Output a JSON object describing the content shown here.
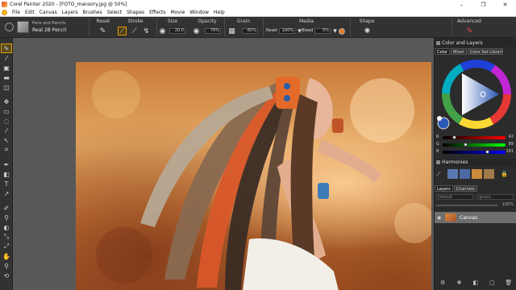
{
  "window": {
    "title": "Corel Painter 2020 - [FOTO_mansory.jpg @ 50%]",
    "controls": [
      "–",
      "❐",
      "✕"
    ]
  },
  "menu": [
    "File",
    "Edit",
    "Canvas",
    "Layers",
    "Brushes",
    "Select",
    "Shapes",
    "Effects",
    "Movie",
    "Window",
    "Help"
  ],
  "property_bar": {
    "brush_category": "Pens and Pencils",
    "brush_variant": "Real 2B Pencil",
    "reset_label": "Reset",
    "stroke_label": "Stroke",
    "size_label": "Size",
    "size_value": "20.0",
    "opacity_label": "Opacity",
    "opacity_value": "70%",
    "grain_label": "Grain",
    "grain_value": "65%",
    "media_label": "Media",
    "media_reset_label": "Reset",
    "media_value": "100%",
    "bleed_label": "Bleed",
    "bleed_value": "5%",
    "shape_label": "Shape",
    "advanced_label": "Advanced"
  },
  "color_panel": {
    "header": "Color and Layers",
    "tabs": [
      "Color",
      "Mixer",
      "Color Set Libraries"
    ],
    "rgb": [
      {
        "label": "R",
        "value": "42",
        "fraction": 0.16
      },
      {
        "label": "G",
        "value": "89",
        "fraction": 0.35
      },
      {
        "label": "B",
        "value": "181",
        "fraction": 0.71
      }
    ],
    "current_color": "#2a59b5"
  },
  "harmonies": {
    "header": "Harmonies",
    "swatches": [
      "#5a78b0",
      "#4d6aa6",
      "#c98a3a",
      "#a17a4a"
    ]
  },
  "layers": {
    "header_tabs": [
      "Layers",
      "Channels"
    ],
    "composite": "Default",
    "composite_method": "Ignore",
    "opacity": "100%",
    "items": [
      {
        "name": "Canvas"
      }
    ]
  }
}
